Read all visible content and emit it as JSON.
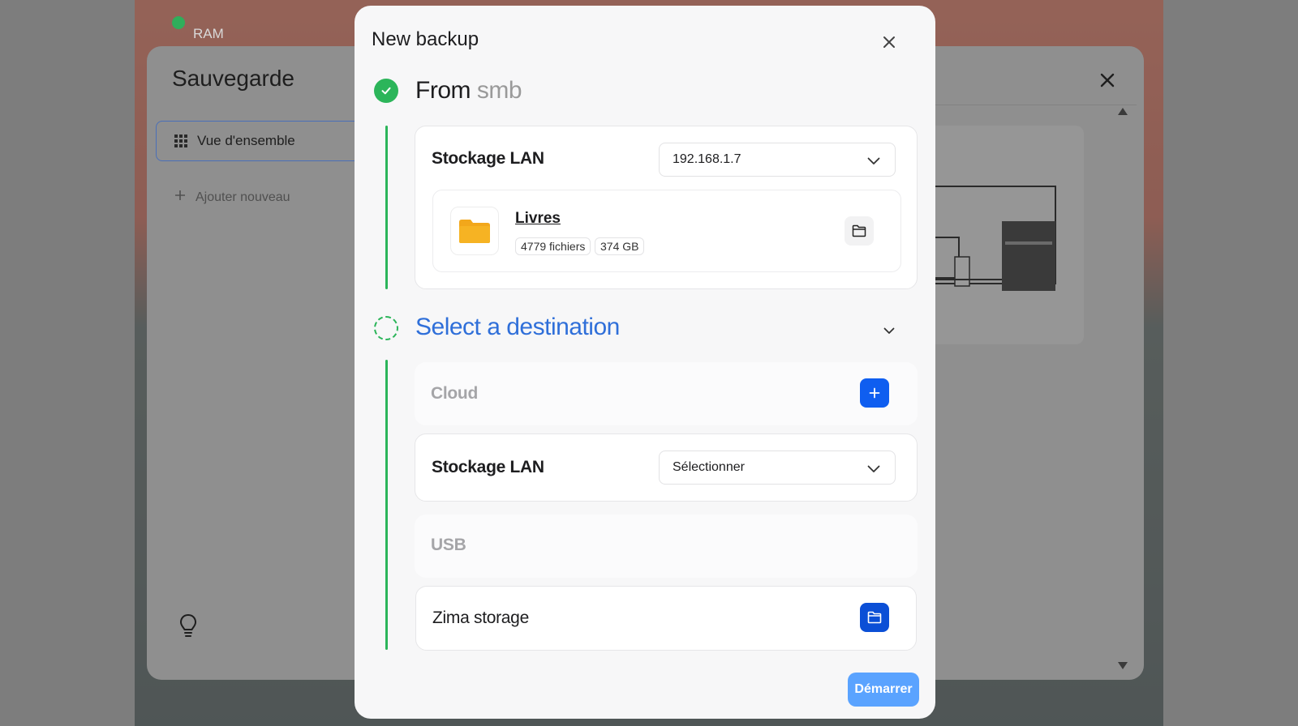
{
  "background": {
    "ram_label": "RAM",
    "window_title": "Sauvegarde",
    "nav_active": "Vue d'ensemble",
    "nav_add": "Ajouter nouveau"
  },
  "modal": {
    "title": "New backup",
    "source": {
      "title_prefix": "From",
      "title_suffix": "smb",
      "storage_label": "Stockage LAN",
      "selected_host": "192.168.1.7",
      "share": {
        "name": "Livres",
        "files": "4779 fichiers",
        "size": "374 GB"
      }
    },
    "destination": {
      "title": "Select a destination",
      "cloud_label": "Cloud",
      "lan_label": "Stockage LAN",
      "lan_select": "Sélectionner",
      "usb_label": "USB",
      "zima_label": "Zima storage"
    },
    "start_button": "Démarrer"
  },
  "colors": {
    "accent_green": "#2cb55a",
    "accent_blue": "#0f5ef0",
    "title_blue": "#2f6fd9",
    "start_button": "#5aa3ff",
    "folder_yellow": "#f2a71b"
  },
  "icons": [
    "close-icon",
    "check-icon",
    "chevron-down-icon",
    "folder-icon",
    "plus-icon",
    "grid-icon",
    "lightbulb-icon"
  ]
}
